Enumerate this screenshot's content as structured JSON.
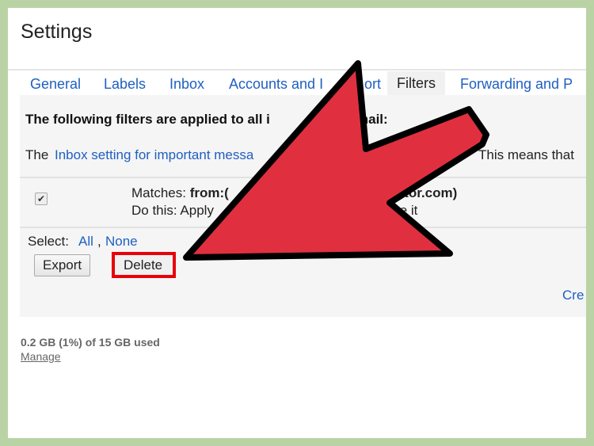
{
  "page": {
    "title": "Settings"
  },
  "tabs": [
    {
      "label": "General"
    },
    {
      "label": "Labels"
    },
    {
      "label": "Inbox"
    },
    {
      "label": "Accounts and I",
      "label_end": "ort"
    },
    {
      "label": "Filters",
      "selected": true
    },
    {
      "label": "Forwarding and P"
    }
  ],
  "filters": {
    "heading_start": "The following filters are applied to all i",
    "heading_end": "mail:",
    "notice_prefix": "The ",
    "notice_link": "Inbox setting for important messa",
    "notice_end": "This means that",
    "row": {
      "checked": true,
      "matches_label": "Matches: ",
      "matches_value_start": "from:(",
      "matches_value_end": "sitor.com)",
      "action_label": "Do this: Apply",
      "action_end": "te it"
    },
    "select_label": "Select: ",
    "select_all": "All",
    "select_none": "None",
    "export_button": "Export",
    "delete_button": "Delete",
    "create_link": "Cre"
  },
  "storage": {
    "usage": "0.2 GB (1%) of 15 GB used",
    "manage_link": "Manage"
  },
  "colors": {
    "arrow_fill": "#e03040",
    "highlight": "#e8000a",
    "link": "#1f5fc1",
    "border": "#b9d3a5"
  }
}
